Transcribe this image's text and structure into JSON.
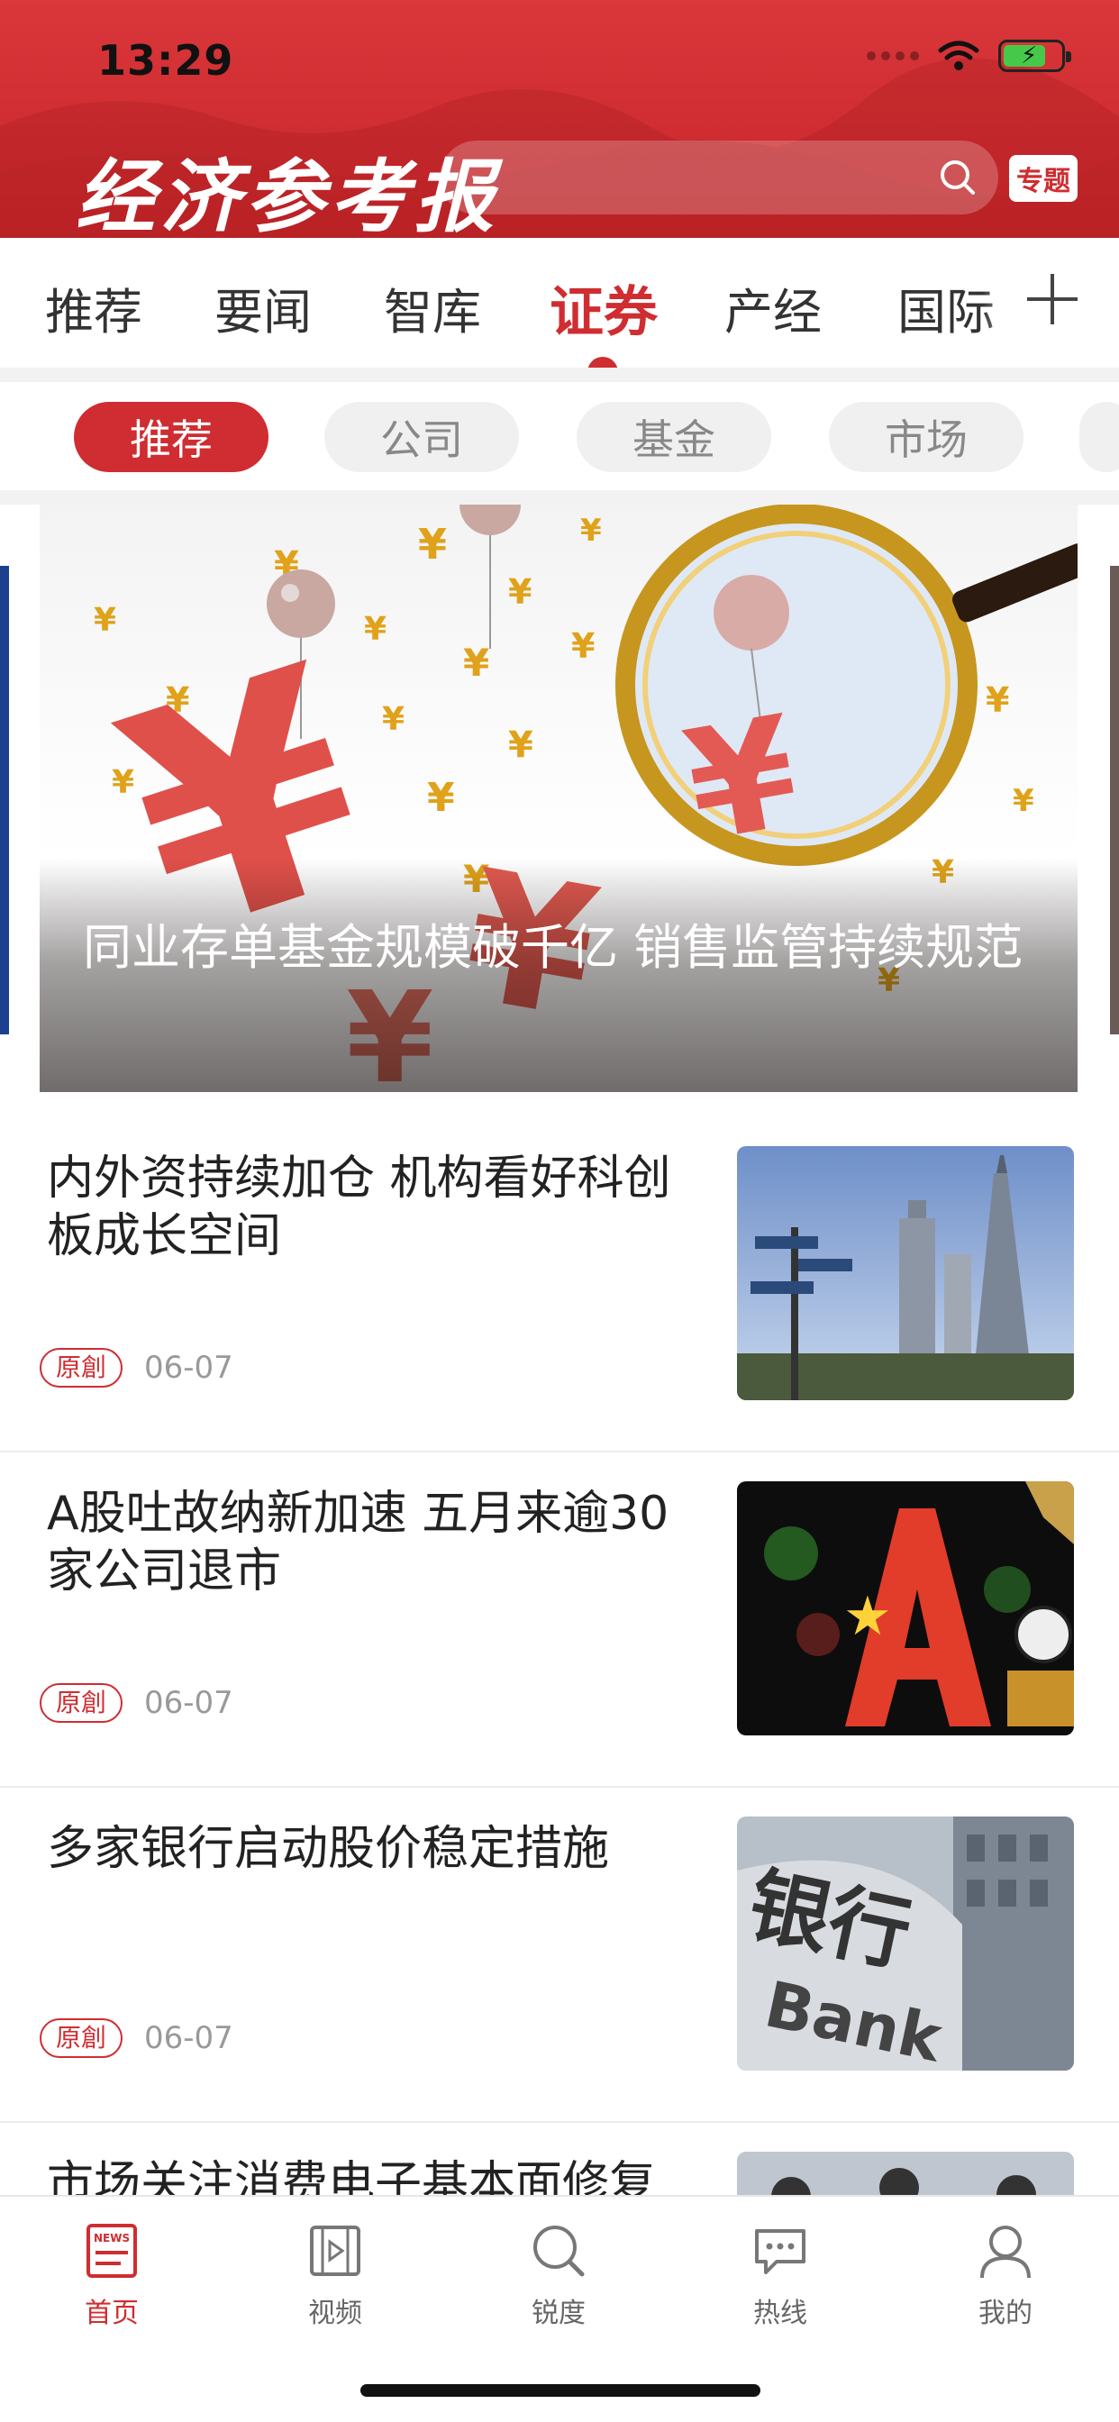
{
  "status_bar": {
    "time": "13:29"
  },
  "header": {
    "logo_text": "经济参考报",
    "search_placeholder": "",
    "special_badge": "专题"
  },
  "channels": [
    {
      "label": "推荐"
    },
    {
      "label": "要闻"
    },
    {
      "label": "智库"
    },
    {
      "label": "证券"
    },
    {
      "label": "产经"
    },
    {
      "label": "国际"
    }
  ],
  "active_channel": "证券",
  "subtabs": [
    {
      "label": "推荐"
    },
    {
      "label": "公司"
    },
    {
      "label": "基金"
    },
    {
      "label": "市场"
    }
  ],
  "active_subtab": "推荐",
  "hero": {
    "title": "同业存单基金规模破千亿  销售监管持续规范"
  },
  "news": [
    {
      "title": "内外资持续加仓    机构看好科创板成长空间",
      "tag": "原創",
      "date": "06-07"
    },
    {
      "title": "A股吐故纳新加速    五月来逾30家公司退市",
      "tag": "原創",
      "date": "06-07"
    },
    {
      "title": "多家银行启动股价稳定措施",
      "tag": "原創",
      "date": "06-07"
    },
    {
      "title": "市场关注消费电子基本面修复",
      "tag": "",
      "date": ""
    }
  ],
  "thumb_texts": {
    "bank_sign_zh": "银行",
    "bank_sign_en": "Bank",
    "news_icon_text": "NEWS"
  },
  "bottom_nav": [
    {
      "label": "首页",
      "icon": "news-icon"
    },
    {
      "label": "视频",
      "icon": "video-icon"
    },
    {
      "label": "锐度",
      "icon": "search-icon"
    },
    {
      "label": "热线",
      "icon": "chat-icon"
    },
    {
      "label": "我的",
      "icon": "user-icon"
    }
  ],
  "colors": {
    "brand_red": "#cf2d31",
    "inactive_gray": "#666666"
  }
}
